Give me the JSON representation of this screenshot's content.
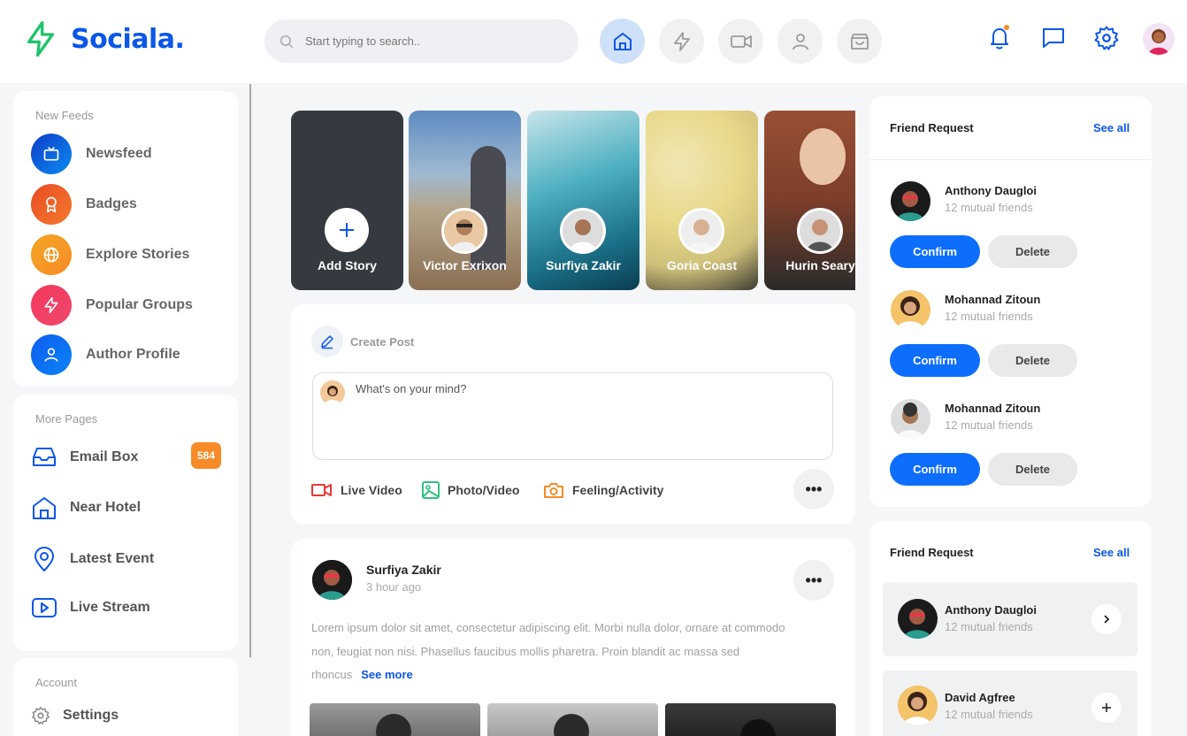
{
  "app": {
    "name": "Sociala."
  },
  "search": {
    "placeholder": "Start typing to search.."
  },
  "header_nav": [
    "home-icon",
    "bolt-icon",
    "video-icon",
    "user-icon",
    "shopping-bag-icon"
  ],
  "colors": {
    "brand": "#0a57e8",
    "primary": "#0d6efd",
    "badge": "#f68b28",
    "logo_green": "#1ec36b"
  },
  "sidebar": {
    "feeds_title": "New Feeds",
    "feeds": [
      {
        "label": "Newsfeed",
        "icon": "tv-icon"
      },
      {
        "label": "Badges",
        "icon": "badge-icon"
      },
      {
        "label": "Explore Stories",
        "icon": "globe-icon"
      },
      {
        "label": "Popular Groups",
        "icon": "bolt-icon"
      },
      {
        "label": "Author Profile",
        "icon": "user-icon"
      }
    ],
    "pages_title": "More Pages",
    "pages": [
      {
        "label": "Email Box",
        "icon": "inbox-icon",
        "count": "584"
      },
      {
        "label": "Near Hotel",
        "icon": "home-icon"
      },
      {
        "label": "Latest Event",
        "icon": "map-pin-icon"
      },
      {
        "label": "Live Stream",
        "icon": "youtube-icon"
      }
    ],
    "account_title": "Account",
    "account": [
      {
        "label": "Settings",
        "icon": "settings-icon"
      }
    ]
  },
  "stories": {
    "add_label": "Add Story",
    "items": [
      {
        "name": "Victor Exrixon"
      },
      {
        "name": "Surfiya Zakir"
      },
      {
        "name": "Goria Coast"
      },
      {
        "name": "Hurin Seary"
      }
    ]
  },
  "create_post": {
    "title": "Create Post",
    "placeholder": "What's on your mind?",
    "actions": [
      {
        "label": "Live Video",
        "icon": "video-icon"
      },
      {
        "label": "Photo/Video",
        "icon": "image-icon"
      },
      {
        "label": "Feeling/Activity",
        "icon": "camera-icon"
      }
    ],
    "more": "•••"
  },
  "post": {
    "author": "Surfiya Zakir",
    "time": "3 hour ago",
    "text": "Lorem ipsum dolor sit amet, consectetur adipiscing elit. Morbi nulla dolor, ornare at commodo non, feugiat non nisi. Phasellus faucibus mollis pharetra. Proin blandit ac massa sed rhoncus",
    "see_more": "See more",
    "more": "•••"
  },
  "friend_requests": {
    "title": "Friend Request",
    "see_all": "See all",
    "confirm": "Confirm",
    "delete": "Delete",
    "items": [
      {
        "name": "Anthony Daugloi",
        "mutual": "12 mutual friends"
      },
      {
        "name": "Mohannad Zitoun",
        "mutual": "12 mutual friends"
      },
      {
        "name": "Mohannad Zitoun",
        "mutual": "12 mutual friends"
      }
    ]
  },
  "friend_requests_2": {
    "title": "Friend Request",
    "see_all": "See all",
    "items": [
      {
        "name": "Anthony Daugloi",
        "mutual": "12 mutual friends",
        "action_icon": "chevron-right-icon"
      },
      {
        "name": "David Agfree",
        "mutual": "12 mutual friends",
        "action_icon": "plus-icon"
      }
    ]
  }
}
